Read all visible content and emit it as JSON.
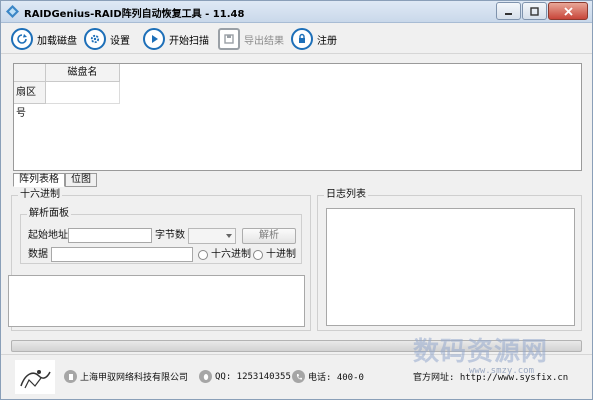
{
  "window": {
    "title": "RAIDGenius-RAID阵列自动恢复工具 - 11.48"
  },
  "toolbar": {
    "load_disk": "加载磁盘",
    "settings": "设置",
    "start_scan": "开始扫描",
    "export_results": "导出结果",
    "register": "注册"
  },
  "grid": {
    "column_header": "磁盘名",
    "row_header": "扇区号"
  },
  "tabs": [
    "阵列表格",
    "位图"
  ],
  "hex_panel": {
    "title": "十六进制",
    "parse_panel": {
      "title": "解析面板",
      "start_address_label": "起始地址",
      "start_address_value": "",
      "byte_count_label": "字节数",
      "byte_count_value": "",
      "parse_button": "解析",
      "data_label": "数据",
      "data_value": "",
      "radio_hex": "十六进制",
      "radio_dec": "十进制"
    }
  },
  "log_panel": {
    "title": "日志列表"
  },
  "footer": {
    "company": "上海甲驭网络科技有限公司",
    "qq": "QQ: 1253140355",
    "phone": "电话: 400-0",
    "website": "官方网址: http://www.sysfix.cn"
  },
  "watermark": {
    "text": "数码资源网",
    "url": "www.smzy.com"
  },
  "colors": {
    "accent": "#1d6fb8",
    "disabled": "#8b8b8b"
  }
}
